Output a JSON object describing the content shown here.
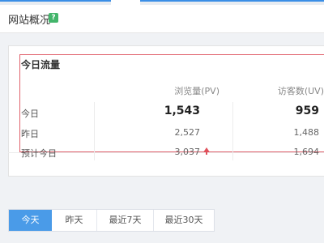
{
  "header": {
    "title": "网站概况",
    "help_icon": "question-icon"
  },
  "traffic": {
    "title": "今日流量",
    "columns": {
      "pv": "浏览量(PV)",
      "uv": "访客数(UV)"
    },
    "rows": [
      {
        "label": "今日",
        "pv": "1,543",
        "uv": "959"
      },
      {
        "label": "昨日",
        "pv": "2,527",
        "uv": "1,488"
      },
      {
        "label": "预计今日",
        "pv": "3,037",
        "uv": "1,694",
        "pv_trend": "up-arrow-icon"
      }
    ]
  },
  "range_tabs": [
    {
      "label": "今天",
      "active": true
    },
    {
      "label": "昨天",
      "active": false
    },
    {
      "label": "最近7天",
      "active": false
    },
    {
      "label": "最近30天",
      "active": false
    }
  ],
  "colors": {
    "accent": "#4a9be8",
    "highlight_border": "#e0606b",
    "trend_up": "#e0505a",
    "help_green": "#43b56b"
  }
}
